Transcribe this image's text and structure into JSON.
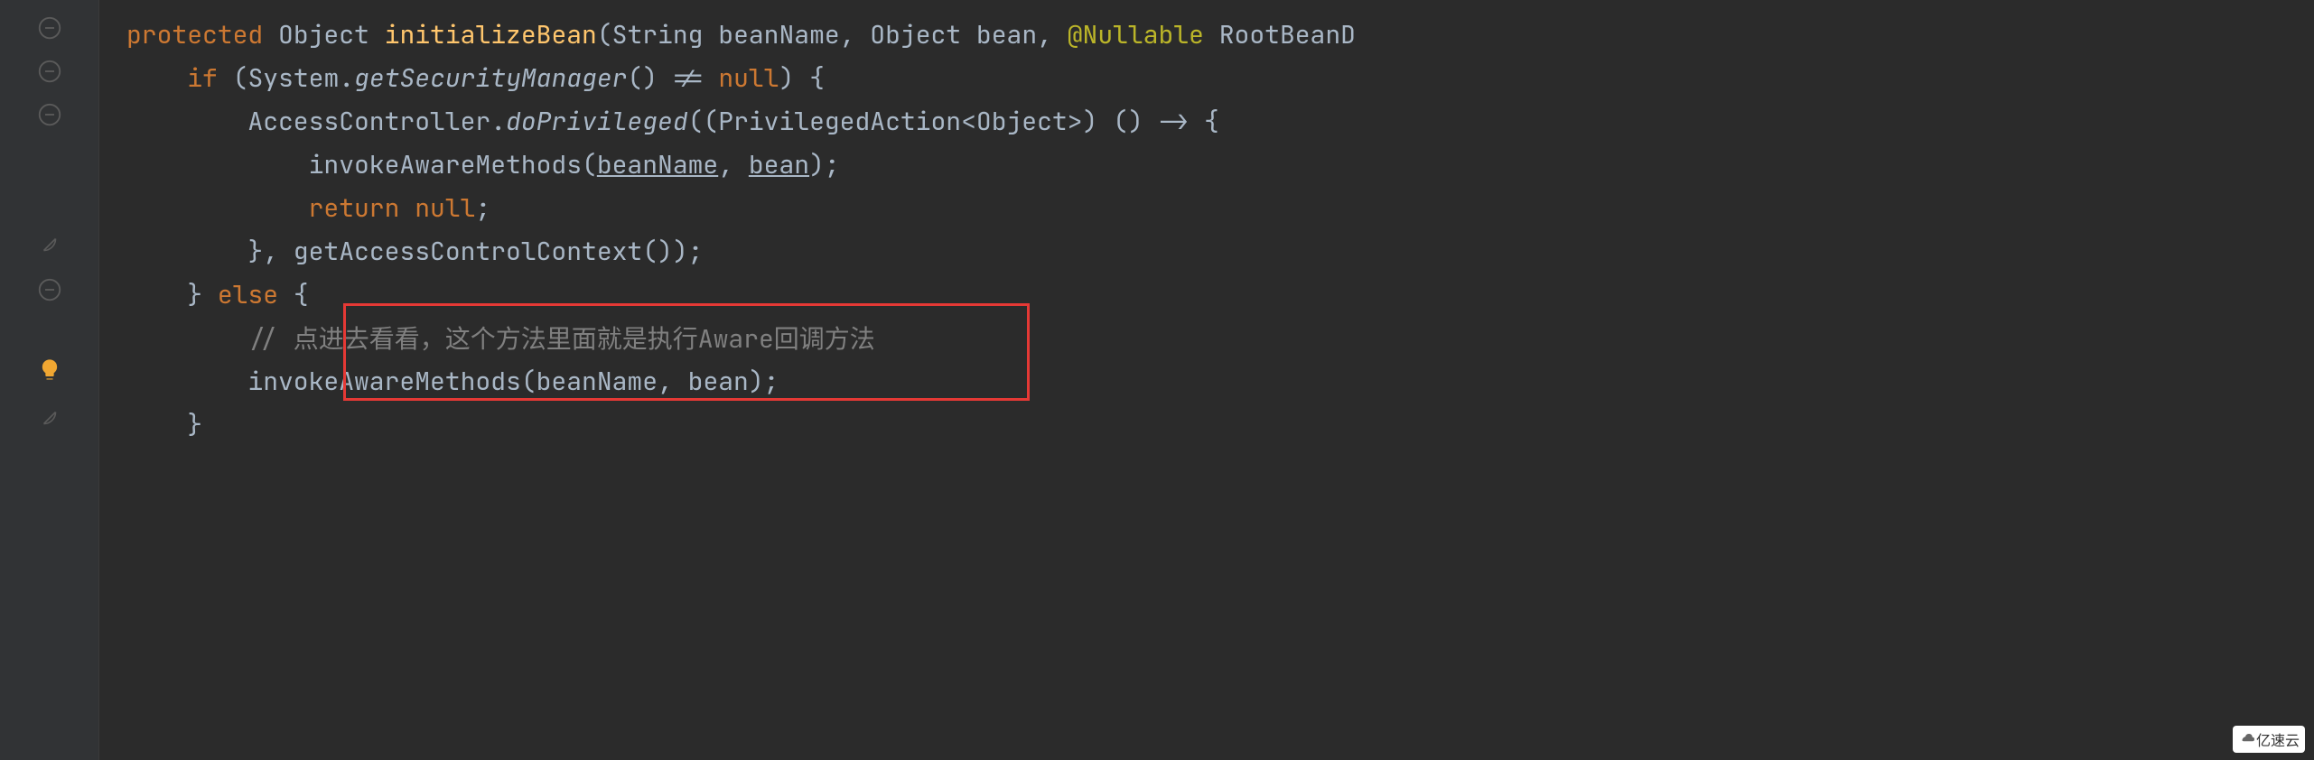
{
  "code": {
    "line1": {
      "protected": "protected",
      "Object": "Object",
      "initializeBean": "initializeBean",
      "String": "String",
      "beanName": "beanName",
      "Object2": "Object",
      "bean": "bean",
      "Nullable": "@Nullable",
      "RootBeanD": "RootBeanD"
    },
    "line2": {
      "if": "if",
      "System": "System",
      "getSecurityManager": "getSecurityManager",
      "nullkw": "null"
    },
    "line3": {
      "AccessController": "AccessController",
      "doPrivileged": "doPrivileged",
      "PrivilegedAction": "PrivilegedAction",
      "Object": "Object"
    },
    "line4": {
      "invokeAwareMethods": "invokeAwareMethods",
      "beanName": "beanName",
      "bean": "bean"
    },
    "line5": {
      "return": "return",
      "nullkw": "null"
    },
    "line6": {
      "getAccessControlContext": "getAccessControlContext"
    },
    "line7": {
      "else": "else"
    },
    "line8": {
      "comment": "// 点进去看看，这个方法里面就是执行Aware回调方法"
    },
    "line9": {
      "invokeAwareMethods": "invokeAwareMethods",
      "beanName": "beanName",
      "bean": "bean"
    }
  },
  "punct": {
    "open_paren": "(",
    "close_paren": ")",
    "open_brace": "{",
    "close_brace": "}",
    "open_angle": "<",
    "close_angle": ">",
    "comma_sp": ", ",
    "semicolon": ";",
    "dot": ".",
    "ne": "!=",
    "arrow": "->"
  },
  "watermark": {
    "text": "亿速云"
  }
}
